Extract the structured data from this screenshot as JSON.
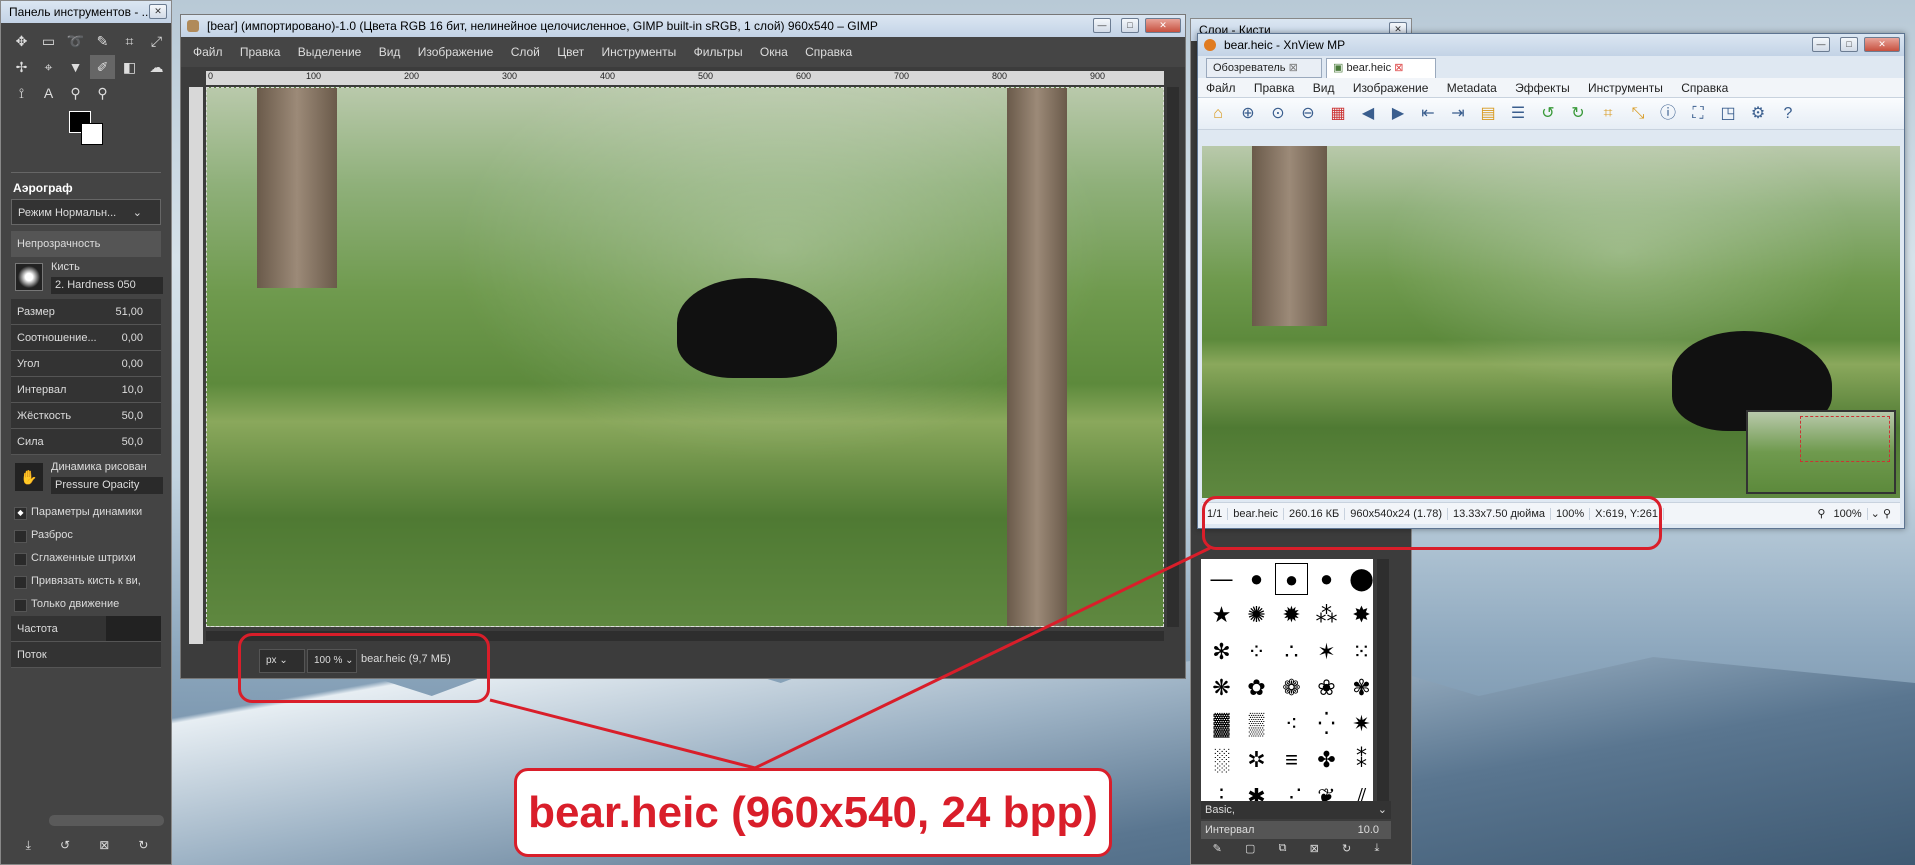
{
  "toolbox": {
    "title": "Панель инструментов - ...",
    "tool_name": "Аэрограф",
    "mode": "Режим Нормальн...",
    "opacity_label": "Непрозрачность",
    "brush_label": "Кисть",
    "brush_name": "2. Hardness 050",
    "params": [
      {
        "label": "Размер",
        "value": "51,00"
      },
      {
        "label": "Соотношение...",
        "value": "0,00"
      },
      {
        "label": "Угол",
        "value": "0,00"
      },
      {
        "label": "Интервал",
        "value": "10,0"
      },
      {
        "label": "Жёсткость",
        "value": "50,0"
      },
      {
        "label": "Сила",
        "value": "50,0"
      }
    ],
    "dynamics_label": "Динамика рисован",
    "dynamics_value": "Pressure Opacity",
    "checks": [
      "Параметры динамики",
      "Разброс",
      "Сглаженные штрихи",
      "Привязать кисть к ви,",
      "Только движение"
    ],
    "rate_label": "Частота",
    "flow_label": "Поток"
  },
  "gimp": {
    "title": "[bear] (импортировано)-1.0 (Цвета RGB 16 бит, нелинейное целочисленное, GIMP built-in sRGB, 1 слой) 960x540 – GIMP",
    "menu": [
      "Файл",
      "Правка",
      "Выделение",
      "Вид",
      "Изображение",
      "Слой",
      "Цвет",
      "Инструменты",
      "Фильтры",
      "Окна",
      "Справка"
    ],
    "ruler_ticks": [
      "0",
      "100",
      "200",
      "300",
      "400",
      "500",
      "600",
      "700",
      "800",
      "900"
    ],
    "unit": "px",
    "zoom": "100 %",
    "status_text": "bear.heic (9,7 МБ)"
  },
  "layers": {
    "title": "Слои - Кисти",
    "preset": "Basic,",
    "interval_label": "Интервал",
    "interval_value": "10.0"
  },
  "xnview": {
    "title": "bear.heic - XnView MP",
    "tabs": [
      "Обозреватель",
      "bear.heic"
    ],
    "menu": [
      "Файл",
      "Правка",
      "Вид",
      "Изображение",
      "Metadata",
      "Эффекты",
      "Инструменты",
      "Справка"
    ],
    "status": [
      "1/1",
      "bear.heic",
      "260.16 КБ",
      "960x540x24 (1.78)",
      "13.33x7.50 дюйма",
      "100%",
      "X:619, Y:261"
    ],
    "zoom": "100%"
  },
  "annotation": {
    "caption": "bear.heic (960x540, 24 bpp)",
    "color": "#d91e2a"
  }
}
